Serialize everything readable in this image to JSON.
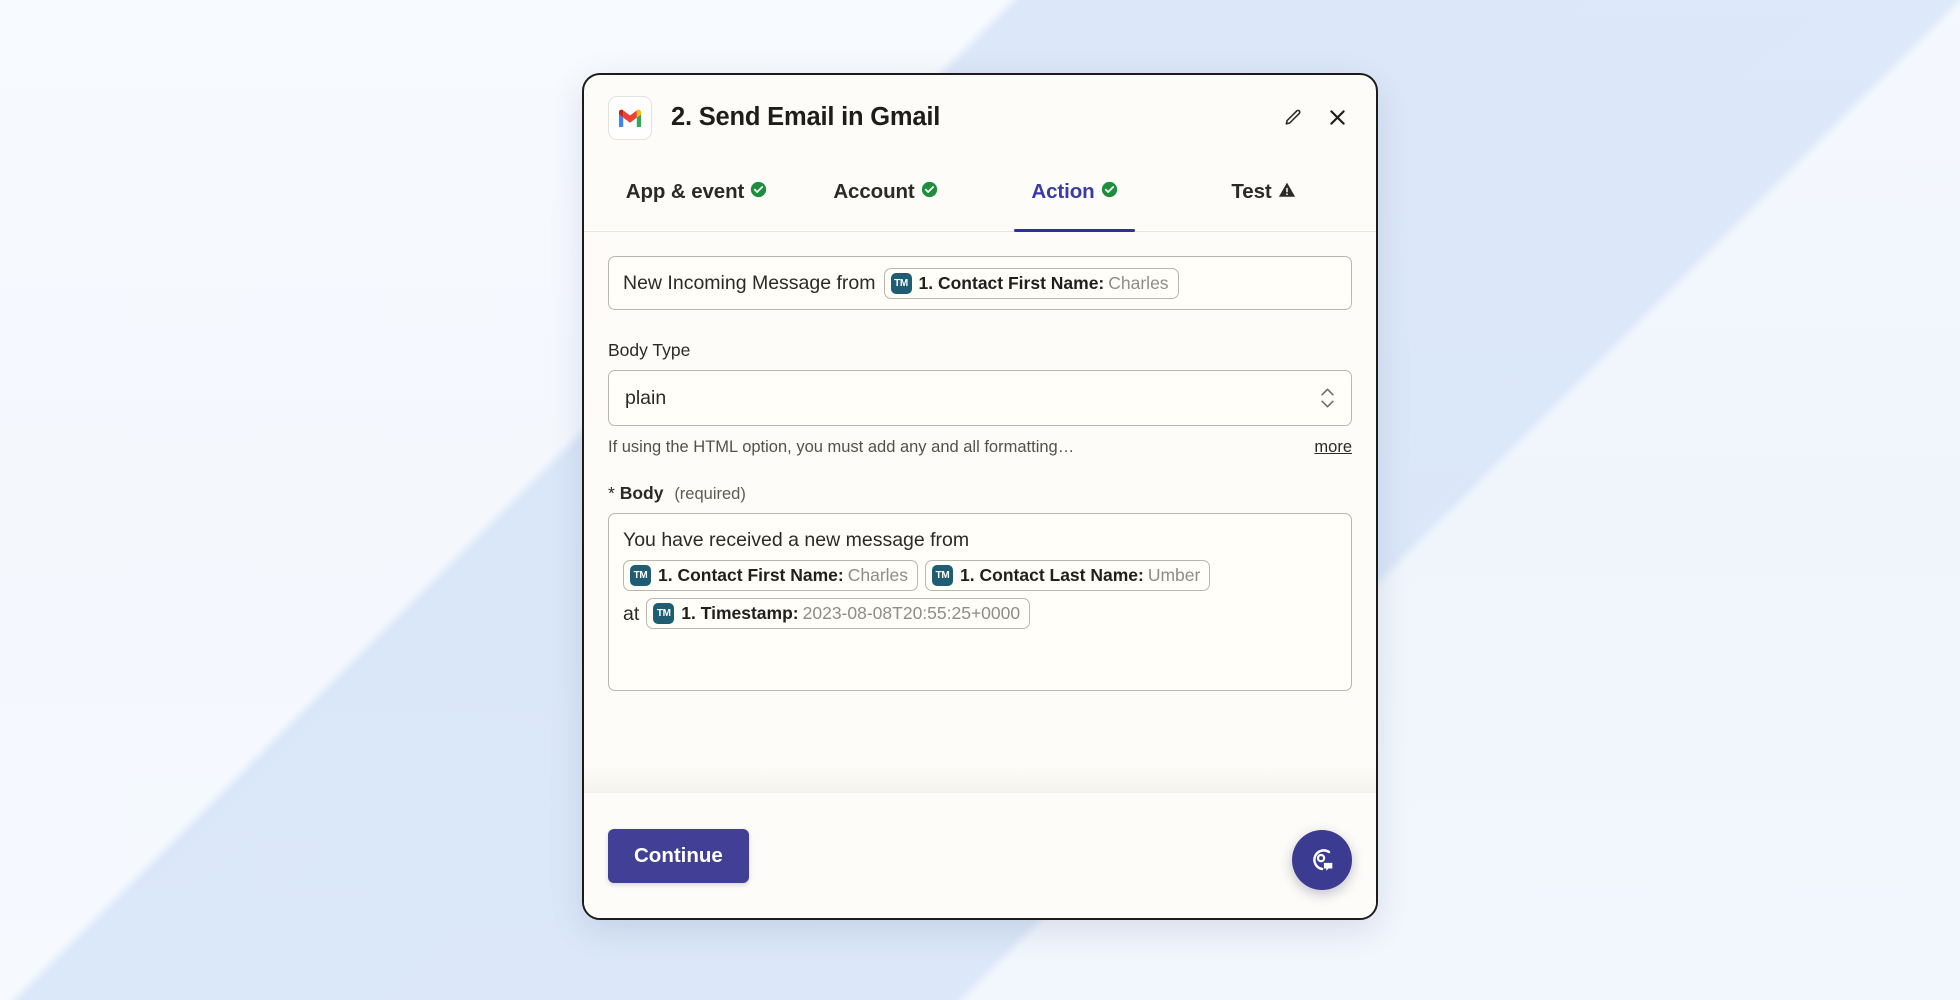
{
  "header": {
    "app_icon": "gmail-icon",
    "title": "2. Send Email in Gmail",
    "edit_icon": "pencil-icon",
    "close_icon": "close-icon"
  },
  "tabs": [
    {
      "label": "App & event",
      "status": "complete",
      "status_icon": "check-circle-icon",
      "active": false
    },
    {
      "label": "Account",
      "status": "complete",
      "status_icon": "check-circle-icon",
      "active": false
    },
    {
      "label": "Action",
      "status": "complete",
      "status_icon": "check-circle-icon",
      "active": true
    },
    {
      "label": "Test",
      "status": "warning",
      "status_icon": "warning-triangle-icon",
      "active": false
    }
  ],
  "subject_field": {
    "prefix_text": "New Incoming Message from",
    "token": {
      "icon": "TM",
      "key": "1. Contact First Name:",
      "value": "Charles"
    }
  },
  "body_type": {
    "label": "Body Type",
    "value": "plain",
    "arrows_icon": "chevron-up-down-icon",
    "helper_text": "If using the HTML option, you must add any and all formatting…",
    "more_label": "more"
  },
  "body": {
    "label_star": "*",
    "label_name": "Body",
    "label_note": "(required)",
    "line1_text": "You have received a new message from",
    "token_first_name": {
      "icon": "TM",
      "key": "1. Contact First Name:",
      "value": "Charles"
    },
    "token_last_name": {
      "icon": "TM",
      "key": "1. Contact Last Name:",
      "value": "Umber"
    },
    "line3_prefix": "at",
    "token_timestamp": {
      "icon": "TM",
      "key": "1. Timestamp:",
      "value": "2023-08-08T20:55:25+0000"
    }
  },
  "footer": {
    "continue_label": "Continue",
    "help_icon": "support-chat-icon"
  },
  "colors": {
    "accent_indigo": "#413f96",
    "active_tab": "#3b3ba8",
    "success_green": "#1e8e3e",
    "token_badge": "#1f5d72",
    "card_bg": "#fdfcf8",
    "page_bg": "#e8f0fc"
  }
}
